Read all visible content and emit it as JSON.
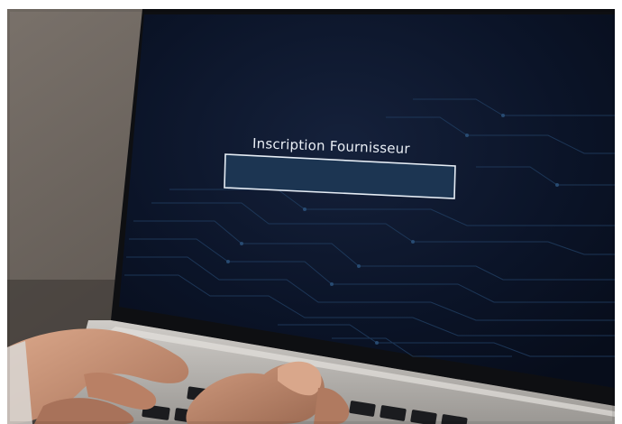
{
  "screen": {
    "title": "Inscription Fournisseur",
    "field_value": ""
  },
  "colors": {
    "screen_bg": "#0b1428",
    "circuit_lines": "#1f3a5c",
    "field_fill": "#1c3552",
    "field_border": "#e6edf5",
    "laptop_bezel": "#101114",
    "laptop_body": "#b9b6b2",
    "skin": "#c89579"
  }
}
